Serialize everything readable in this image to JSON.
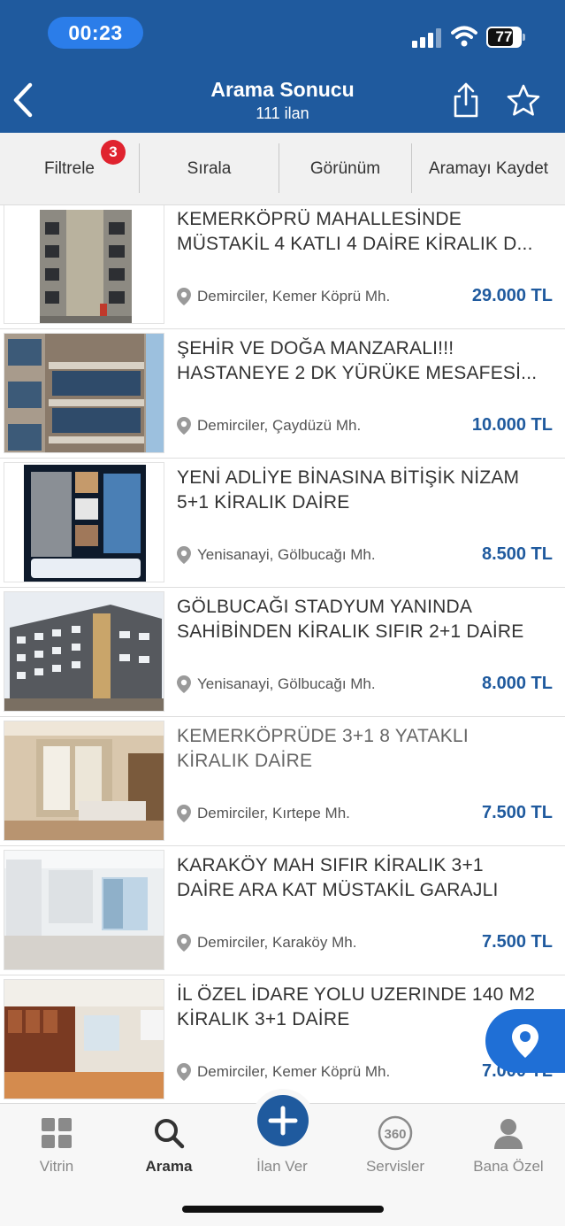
{
  "status_bar": {
    "time": "00:23",
    "battery": "77",
    "battery_level": 0.77
  },
  "header": {
    "title": "Arama Sonucu",
    "subtitle": "111 ilan"
  },
  "toolbar": {
    "filter": "Filtrele",
    "filter_badge": "3",
    "sort": "Sırala",
    "view": "Görünüm",
    "save_search": "Aramayı Kaydet"
  },
  "listings": [
    {
      "title_1": "KEMERKÖPRÜ MAHALLESİNDE",
      "title_2": "MÜSTAKİL 4 KATLI 4 DAİRE KİRALIK D...",
      "location": "Demirciler, Kemer Köprü Mh.",
      "price": "29.000 TL"
    },
    {
      "title_1": "ŞEHİR VE DOĞA MANZARALI!!!",
      "title_2": "HASTANEYE 2 DK YÜRÜKE MESAFESİ...",
      "location": "Demirciler, Çaydüzü Mh.",
      "price": "10.000 TL"
    },
    {
      "title_1": "YENİ ADLİYE BİNASINA BİTİŞİK NİZAM",
      "title_2": "5+1 KİRALIK DAİRE",
      "location": "Yenisanayi, Gölbucağı Mh.",
      "price": "8.500 TL"
    },
    {
      "title_1": "GÖLBUCAĞI STADYUM YANINDA",
      "title_2": "SAHİBİNDEN KİRALIK SIFIR 2+1 DAİRE",
      "location": "Yenisanayi, Gölbucağı Mh.",
      "price": "8.000 TL"
    },
    {
      "title_1": "KEMERKÖPRÜDE 3+1 8 YATAKLI",
      "title_2": "KİRALIK DAİRE",
      "location": "Demirciler, Kırtepe Mh.",
      "price": "7.500 TL"
    },
    {
      "title_1": "KARAKÖY MAH SIFIR KİRALIK 3+1",
      "title_2": "DAİRE ARA KAT MÜSTAKİL GARAJLI",
      "location": "Demirciler, Karaköy Mh.",
      "price": "7.500 TL"
    },
    {
      "title_1": "İL ÖZEL İDARE YOLU UZERINDE 140 M2",
      "title_2": "KİRALIK 3+1 DAİRE",
      "location": "Demirciler, Kemer Köprü Mh.",
      "price": "7.000 TL"
    }
  ],
  "bottom_nav": {
    "showcase": "Vitrin",
    "search": "Arama",
    "post_ad": "İlan Ver",
    "services": "Servisler",
    "services_icon_text": "360",
    "personal": "Bana Özel"
  },
  "colors": {
    "brand": "#1f5a9e",
    "badge": "#e0232f",
    "fab": "#1f6fd6"
  },
  "icons": [
    "chevron-left-icon",
    "share-icon",
    "star-icon",
    "pin-icon",
    "grid-icon",
    "search-icon",
    "plus-icon",
    "360-icon",
    "person-icon"
  ]
}
